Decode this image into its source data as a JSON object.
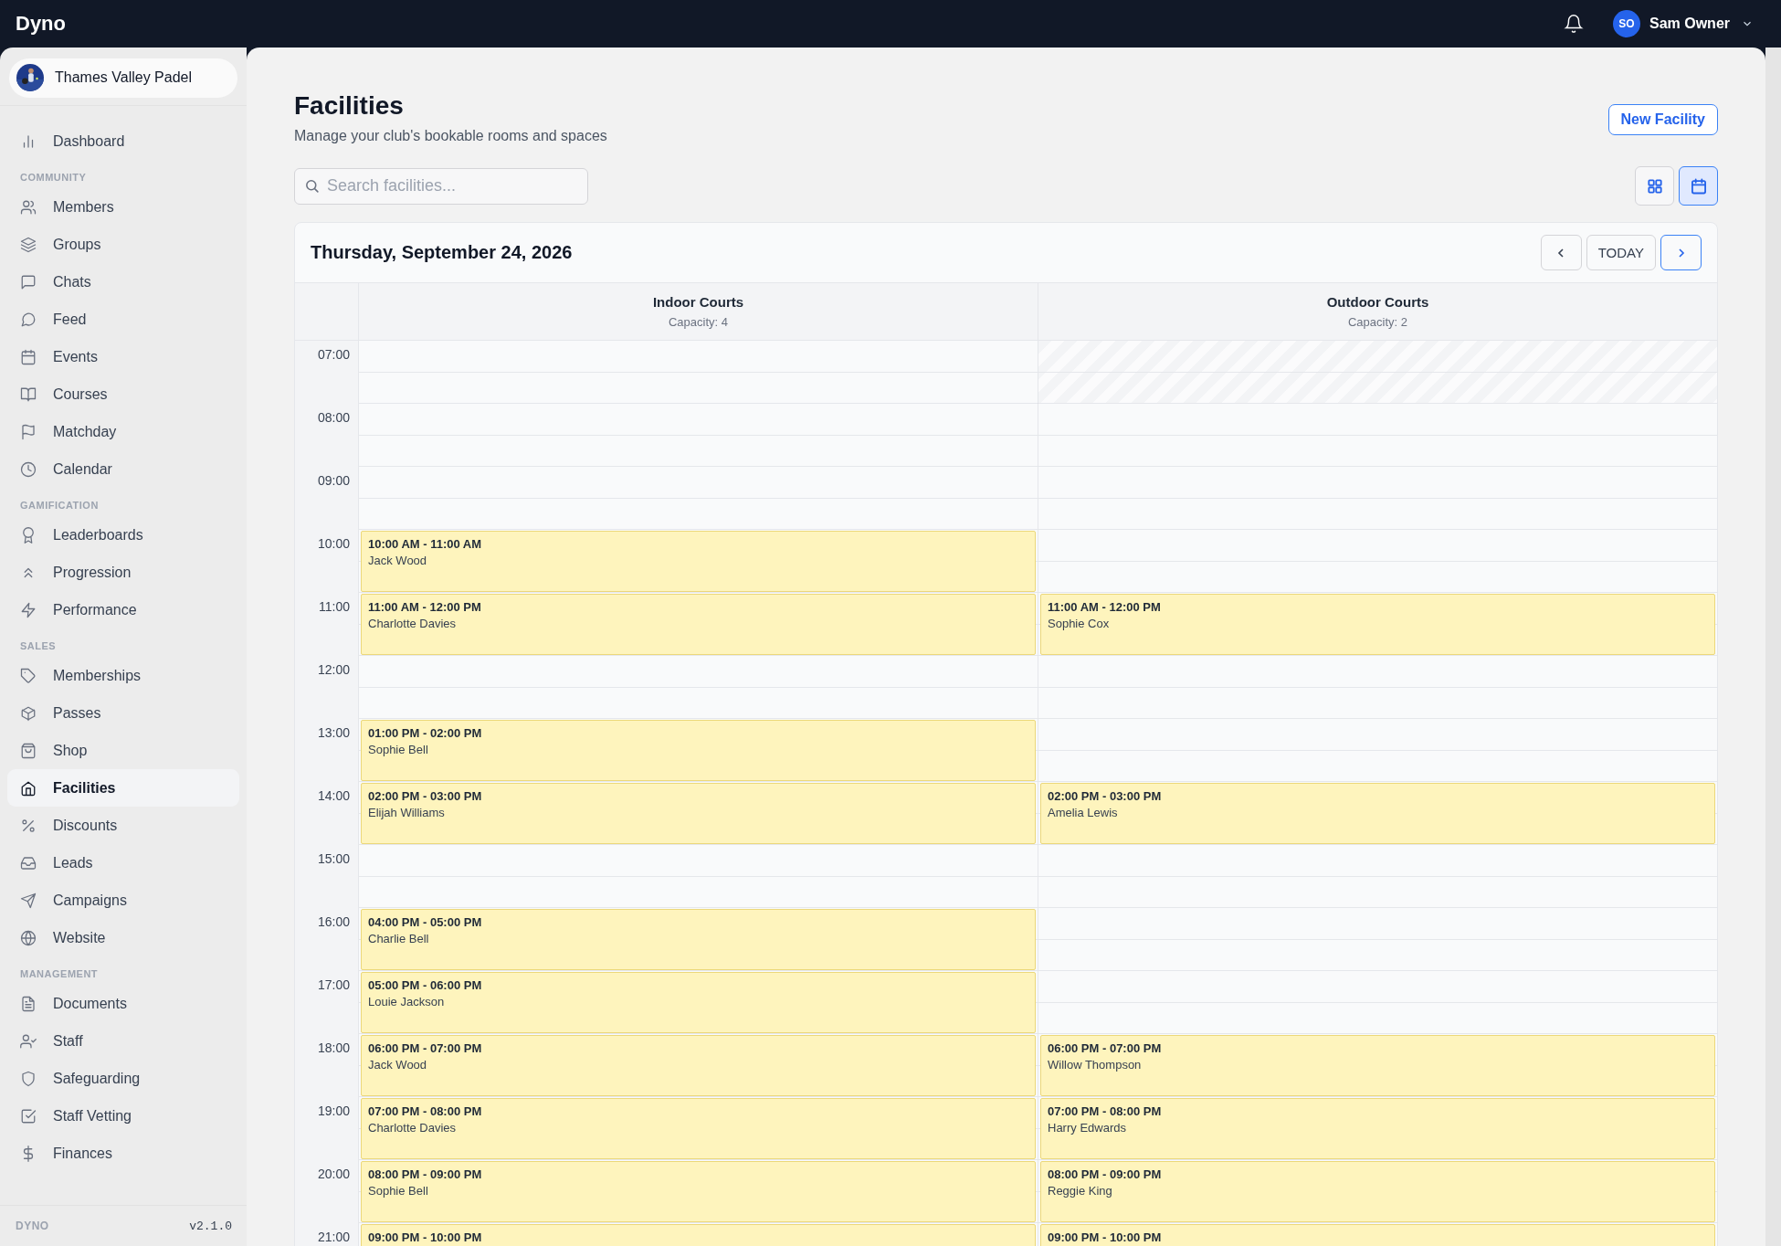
{
  "topbar": {
    "brand": "Dyno",
    "user": {
      "initials": "SO",
      "name": "Sam Owner"
    }
  },
  "sidebar": {
    "org": "Thames Valley Padel",
    "sections": [
      {
        "items": [
          {
            "label": "Dashboard",
            "selected": false
          }
        ]
      },
      {
        "title": "COMMUNITY",
        "items": [
          {
            "label": "Members",
            "selected": false
          },
          {
            "label": "Groups",
            "selected": false
          },
          {
            "label": "Chats",
            "selected": false
          },
          {
            "label": "Feed",
            "selected": false
          },
          {
            "label": "Events",
            "selected": false
          },
          {
            "label": "Courses",
            "selected": false
          },
          {
            "label": "Matchday",
            "selected": false
          },
          {
            "label": "Calendar",
            "selected": false
          }
        ]
      },
      {
        "title": "GAMIFICATION",
        "items": [
          {
            "label": "Leaderboards",
            "selected": false
          },
          {
            "label": "Progression",
            "selected": false
          },
          {
            "label": "Performance",
            "selected": false
          }
        ]
      },
      {
        "title": "SALES",
        "items": [
          {
            "label": "Memberships",
            "selected": false
          },
          {
            "label": "Passes",
            "selected": false
          },
          {
            "label": "Shop",
            "selected": false
          },
          {
            "label": "Facilities",
            "selected": true
          },
          {
            "label": "Discounts",
            "selected": false
          },
          {
            "label": "Leads",
            "selected": false
          },
          {
            "label": "Campaigns",
            "selected": false
          },
          {
            "label": "Website",
            "selected": false
          }
        ]
      },
      {
        "title": "MANAGEMENT",
        "items": [
          {
            "label": "Documents",
            "selected": false
          },
          {
            "label": "Staff",
            "selected": false
          },
          {
            "label": "Safeguarding",
            "selected": false
          },
          {
            "label": "Staff Vetting",
            "selected": false
          },
          {
            "label": "Finances",
            "selected": false
          }
        ]
      }
    ],
    "footer": {
      "brand": "DYNO",
      "version": "v2.1.0"
    }
  },
  "page": {
    "title": "Facilities",
    "subtitle": "Manage your club's bookable rooms and spaces",
    "new_button": "New Facility"
  },
  "search": {
    "placeholder": "Search facilities..."
  },
  "view_toggle": [
    {
      "kind": "grid",
      "selected": false
    },
    {
      "kind": "calendar",
      "selected": true
    }
  ],
  "calendar": {
    "date": "Thursday, September 24, 2026",
    "today_button": "TODAY",
    "columns": [
      {
        "name": "Indoor Courts",
        "capacity": "Capacity: 4"
      },
      {
        "name": "Outdoor Courts",
        "capacity": "Capacity: 2"
      }
    ],
    "rows": [
      {
        "time": "07:00",
        "cells": [
          {
            "kind": "free"
          },
          {
            "kind": "closed"
          }
        ]
      },
      {
        "time": "08:00",
        "cells": [
          {
            "kind": "free"
          },
          {
            "kind": "free"
          }
        ]
      },
      {
        "time": "09:00",
        "cells": [
          {
            "kind": "free"
          },
          {
            "kind": "free"
          }
        ]
      },
      {
        "time": "10:00",
        "cells": [
          {
            "kind": "booked",
            "range": "10:00 AM - 11:00 AM",
            "name": "Jack Wood"
          },
          {
            "kind": "free"
          }
        ]
      },
      {
        "time": "11:00",
        "cells": [
          {
            "kind": "booked",
            "range": "11:00 AM - 12:00 PM",
            "name": "Charlotte Davies"
          },
          {
            "kind": "booked",
            "range": "11:00 AM - 12:00 PM",
            "name": "Sophie Cox"
          }
        ]
      },
      {
        "time": "12:00",
        "cells": [
          {
            "kind": "free"
          },
          {
            "kind": "free"
          }
        ]
      },
      {
        "time": "13:00",
        "cells": [
          {
            "kind": "booked",
            "range": "01:00 PM - 02:00 PM",
            "name": "Sophie Bell"
          },
          {
            "kind": "free"
          }
        ]
      },
      {
        "time": "14:00",
        "cells": [
          {
            "kind": "booked",
            "range": "02:00 PM - 03:00 PM",
            "name": "Elijah Williams"
          },
          {
            "kind": "booked",
            "range": "02:00 PM - 03:00 PM",
            "name": "Amelia Lewis"
          }
        ]
      },
      {
        "time": "15:00",
        "cells": [
          {
            "kind": "free"
          },
          {
            "kind": "free"
          }
        ]
      },
      {
        "time": "16:00",
        "cells": [
          {
            "kind": "booked",
            "range": "04:00 PM - 05:00 PM",
            "name": "Charlie Bell"
          },
          {
            "kind": "free"
          }
        ]
      },
      {
        "time": "17:00",
        "cells": [
          {
            "kind": "booked",
            "range": "05:00 PM - 06:00 PM",
            "name": "Louie Jackson"
          },
          {
            "kind": "free"
          }
        ]
      },
      {
        "time": "18:00",
        "cells": [
          {
            "kind": "booked",
            "range": "06:00 PM - 07:00 PM",
            "name": "Jack Wood"
          },
          {
            "kind": "booked",
            "range": "06:00 PM - 07:00 PM",
            "name": "Willow Thompson"
          }
        ]
      },
      {
        "time": "19:00",
        "cells": [
          {
            "kind": "booked",
            "range": "07:00 PM - 08:00 PM",
            "name": "Charlotte Davies"
          },
          {
            "kind": "booked",
            "range": "07:00 PM - 08:00 PM",
            "name": "Harry Edwards"
          }
        ]
      },
      {
        "time": "20:00",
        "cells": [
          {
            "kind": "booked",
            "range": "08:00 PM - 09:00 PM",
            "name": "Sophie Bell"
          },
          {
            "kind": "booked",
            "range": "08:00 PM - 09:00 PM",
            "name": "Reggie King"
          }
        ]
      },
      {
        "time": "21:00",
        "cells": [
          {
            "kind": "booked",
            "range": "09:00 PM - 10:00 PM"
          },
          {
            "kind": "booked",
            "range": "09:00 PM - 10:00 PM"
          }
        ]
      }
    ]
  }
}
